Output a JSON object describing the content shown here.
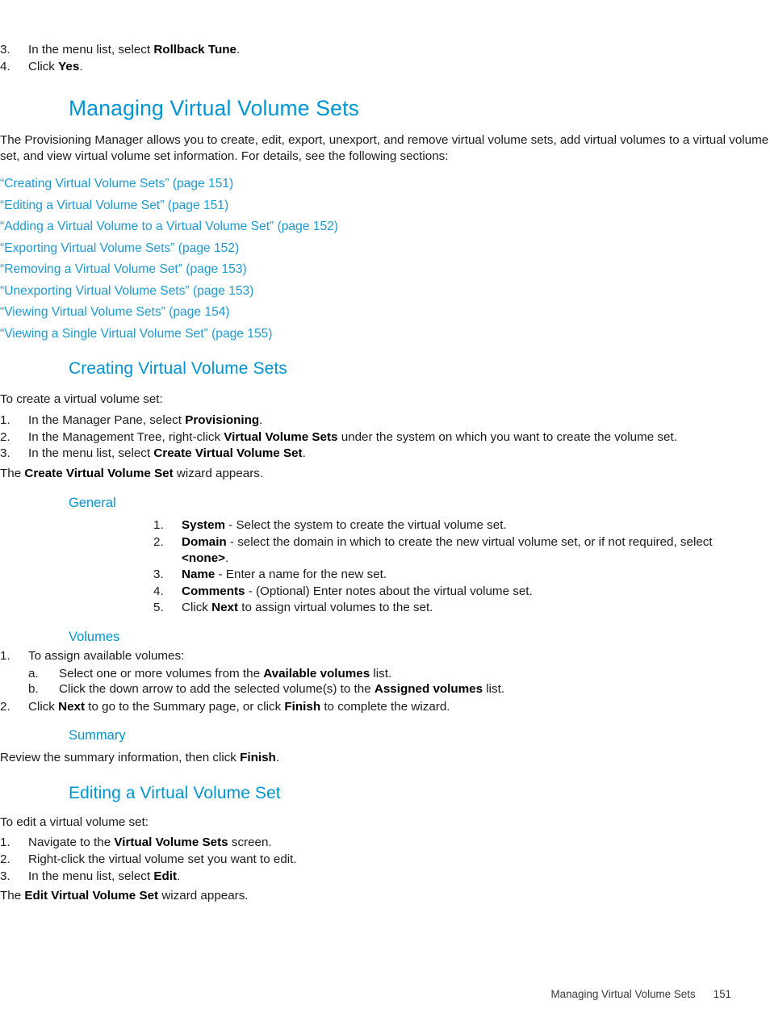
{
  "page": {
    "number": "151",
    "footer_title": "Managing Virtual Volume Sets"
  },
  "colors": {
    "heading_blue": "#0096d6",
    "link_blue": "#1b9ad6",
    "body_black": "#1a1a1a",
    "page_background": "#ffffff"
  },
  "continued_list": {
    "items": [
      {
        "marker": "3.",
        "pre": "In the menu list, select ",
        "bold": "Rollback Tune",
        "post": "."
      },
      {
        "marker": "4.",
        "pre": "Click ",
        "bold": "Yes",
        "post": "."
      }
    ]
  },
  "managing_section": {
    "heading": "Managing Virtual Volume Sets",
    "intro": "The Provisioning Manager allows you to create, edit, export, unexport, and remove virtual volume sets, add virtual volumes to a virtual volume set, and view virtual volume set information. For details, see the following sections:",
    "links": [
      {
        "title": "“Creating Virtual Volume Sets”",
        "page_ref": "(page 151)"
      },
      {
        "title": "“Editing a Virtual Volume Set”",
        "page_ref": "(page 151)"
      },
      {
        "title": "“Adding a Virtual Volume to a Virtual Volume Set”",
        "page_ref": "(page 152)"
      },
      {
        "title": "“Exporting Virtual Volume Sets”",
        "page_ref": "(page 152)"
      },
      {
        "title": "“Removing a Virtual Volume Set”",
        "page_ref": "(page 153)"
      },
      {
        "title": "“Unexporting Virtual Volume Sets”",
        "page_ref": "(page 153)"
      },
      {
        "title": "“Viewing Virtual Volume Sets”",
        "page_ref": "(page 154)"
      },
      {
        "title": "“Viewing a Single Virtual Volume Set”",
        "page_ref": "(page 155)"
      }
    ]
  },
  "creating_section": {
    "heading": "Creating Virtual Volume Sets",
    "lead": "To create a virtual volume set:",
    "steps": [
      {
        "marker": "1.",
        "pre": "In the Manager Pane, select ",
        "bold": "Provisioning",
        "post": "."
      },
      {
        "marker": "2.",
        "pre": "In the Management Tree, right-click ",
        "bold": "Virtual Volume Sets",
        "post": " under the system on which you want to create the volume set."
      },
      {
        "marker": "3.",
        "pre": "In the menu list, select ",
        "bold": "Create Virtual Volume Set",
        "post": "."
      }
    ],
    "closing_pre": "The ",
    "closing_bold": "Create Virtual Volume Set",
    "closing_post": " wizard appears."
  },
  "general_subsection": {
    "heading": "General",
    "steps": [
      {
        "marker": "1.",
        "bold": "System",
        "text": " - Select the system to create the virtual volume set."
      },
      {
        "marker": "2.",
        "bold": "Domain",
        "text": " - select the domain in which to create the new virtual volume set, or if not required, select ",
        "bold2": "<none>",
        "text2": "."
      },
      {
        "marker": "3.",
        "bold": "Name",
        "text": " - Enter a name for the new set."
      },
      {
        "marker": "4.",
        "bold": "Comments",
        "text": " - (Optional) Enter notes about the virtual volume set."
      },
      {
        "marker": "5.",
        "pre": "Click ",
        "bold": "Next",
        "text": " to assign virtual volumes to the set."
      }
    ]
  },
  "volumes_subsection": {
    "heading": "Volumes",
    "step1_marker": "1.",
    "step1_text": "To assign available volumes:",
    "substeps": [
      {
        "marker": "a.",
        "pre": "Select one or more volumes from the ",
        "bold": "Available volumes",
        "post": " list."
      },
      {
        "marker": "b.",
        "pre": "Click the down arrow to add the selected volume(s) to the ",
        "bold": "Assigned volumes",
        "post": " list."
      }
    ],
    "step2_marker": "2.",
    "step2_pre": "Click ",
    "step2_bold1": "Next",
    "step2_mid": " to go to the Summary page, or click ",
    "step2_bold2": "Finish",
    "step2_post": " to complete the wizard."
  },
  "summary_subsection": {
    "heading": "Summary",
    "pre": "Review the summary information, then click ",
    "bold": "Finish",
    "post": "."
  },
  "editing_section": {
    "heading": "Editing a Virtual Volume Set",
    "lead": "To edit a virtual volume set:",
    "steps": [
      {
        "marker": "1.",
        "pre": "Navigate to the ",
        "bold": "Virtual Volume Sets",
        "post": " screen."
      },
      {
        "marker": "2.",
        "pre": "Right-click the virtual volume set you want to edit.",
        "bold": "",
        "post": ""
      },
      {
        "marker": "3.",
        "pre": "In the menu list, select ",
        "bold": "Edit",
        "post": "."
      }
    ],
    "closing_pre": "The ",
    "closing_bold": "Edit Virtual Volume Set",
    "closing_post": " wizard appears."
  }
}
